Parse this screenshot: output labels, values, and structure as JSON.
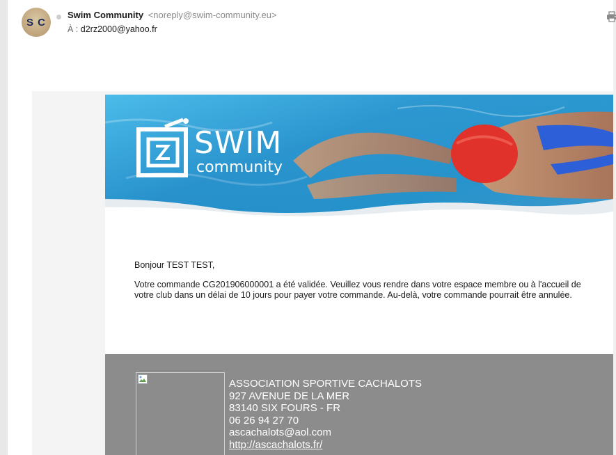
{
  "header": {
    "avatar_initials": "S C",
    "sender_name": "Swim Community",
    "sender_email": "<noreply@swim-community.eu>",
    "to_label": "À :",
    "to_address": "d2rz2000@yahoo.fr",
    "print_icon": "print-icon"
  },
  "banner": {
    "logo_word1": "SWIM",
    "logo_word2": "community"
  },
  "content": {
    "greeting": "Bonjour TEST TEST,",
    "message": "Votre commande CG201906000001 a été validée. Veuillez vous rendre dans votre espace membre ou à l'accueil de votre club dans un délai de 10 jours pour payer votre commande. Au-delà, votre commande pourrait être annulée."
  },
  "footer": {
    "org_name": "ASSOCIATION SPORTIVE CACHALOTS",
    "address_line1": "927 AVENUE DE LA MER",
    "address_line2": "83140 SIX FOURS - FR",
    "phone": "06 26 94 27 70",
    "email": "ascachalots@aol.com",
    "website": "http://ascachalots.fr/"
  },
  "colors": {
    "footer_bg": "#8c8c8c",
    "cap_red": "#e0322b",
    "water_blue": "#1b86c8"
  }
}
